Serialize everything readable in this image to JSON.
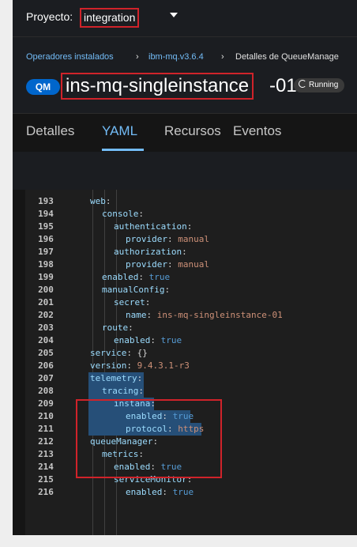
{
  "project": {
    "label": "Proyecto:",
    "value": "integration"
  },
  "breadcrumbs": [
    "Operadores instalados",
    "ibm-mq.v3.6.4",
    "Detalles de QueueManage"
  ],
  "resource": {
    "kind_badge": "QM",
    "name": "ins-mq-singleinstance",
    "suffix": "-01",
    "status": "Running"
  },
  "tabs": [
    {
      "label": "Detalles",
      "active": false
    },
    {
      "label": "YAML",
      "active": true
    },
    {
      "label": "Recursos",
      "active": false
    },
    {
      "label": "Eventos",
      "active": false
    }
  ],
  "editor": {
    "lines": [
      {
        "num": "193",
        "indent": 0,
        "key": "web",
        "sep": ":",
        "value": ""
      },
      {
        "num": "194",
        "indent": 1,
        "key": "console",
        "sep": ":",
        "value": ""
      },
      {
        "num": "195",
        "indent": 2,
        "key": "authentication",
        "sep": ":",
        "value": ""
      },
      {
        "num": "196",
        "indent": 3,
        "key": "provider",
        "sep": ": ",
        "value": "manual"
      },
      {
        "num": "197",
        "indent": 2,
        "key": "authorization",
        "sep": ":",
        "value": ""
      },
      {
        "num": "198",
        "indent": 3,
        "key": "provider",
        "sep": ": ",
        "value": "manual"
      },
      {
        "num": "199",
        "indent": 1,
        "key": "enabled",
        "sep": ": ",
        "value": "true"
      },
      {
        "num": "200",
        "indent": 1,
        "key": "manualConfig",
        "sep": ":",
        "value": ""
      },
      {
        "num": "201",
        "indent": 2,
        "key": "secret",
        "sep": ":",
        "value": ""
      },
      {
        "num": "202",
        "indent": 3,
        "key": "name",
        "sep": ": ",
        "value": "ins-mq-singleinstance-01"
      },
      {
        "num": "203",
        "indent": 1,
        "key": "route",
        "sep": ":",
        "value": ""
      },
      {
        "num": "204",
        "indent": 2,
        "key": "enabled",
        "sep": ": ",
        "value": "true"
      },
      {
        "num": "205",
        "indent": 0,
        "key": "service",
        "sep": ": ",
        "value": "{}"
      },
      {
        "num": "206",
        "indent": 0,
        "key": "version",
        "sep": ": ",
        "value": "9.4.3.1-r3"
      },
      {
        "num": "207",
        "indent": 0,
        "key": "telemetry",
        "sep": ":",
        "value": ""
      },
      {
        "num": "208",
        "indent": 1,
        "key": "tracing",
        "sep": ":",
        "value": ""
      },
      {
        "num": "209",
        "indent": 2,
        "key": "instana",
        "sep": ":",
        "value": ""
      },
      {
        "num": "210",
        "indent": 3,
        "key": "enabled",
        "sep": ": ",
        "value": "true"
      },
      {
        "num": "211",
        "indent": 3,
        "key": "protocol",
        "sep": ": ",
        "value": "https"
      },
      {
        "num": "212",
        "indent": 0,
        "key": "queueManager",
        "sep": ":",
        "value": ""
      },
      {
        "num": "213",
        "indent": 1,
        "key": "metrics",
        "sep": ":",
        "value": ""
      },
      {
        "num": "214",
        "indent": 2,
        "key": "enabled",
        "sep": ": ",
        "value": "true"
      },
      {
        "num": "215",
        "indent": 2,
        "key": "serviceMonitor",
        "sep": ":",
        "value": ""
      },
      {
        "num": "216",
        "indent": 3,
        "key": "enabled",
        "sep": ": ",
        "value": "true"
      }
    ]
  },
  "colors": {
    "link": "#73bcf7",
    "highlight_box": "#d0232a",
    "badge": "#0066cc",
    "selection": "#264f78"
  },
  "icons": {
    "status": "sync-icon",
    "project_dropdown": "caret-down-icon"
  }
}
